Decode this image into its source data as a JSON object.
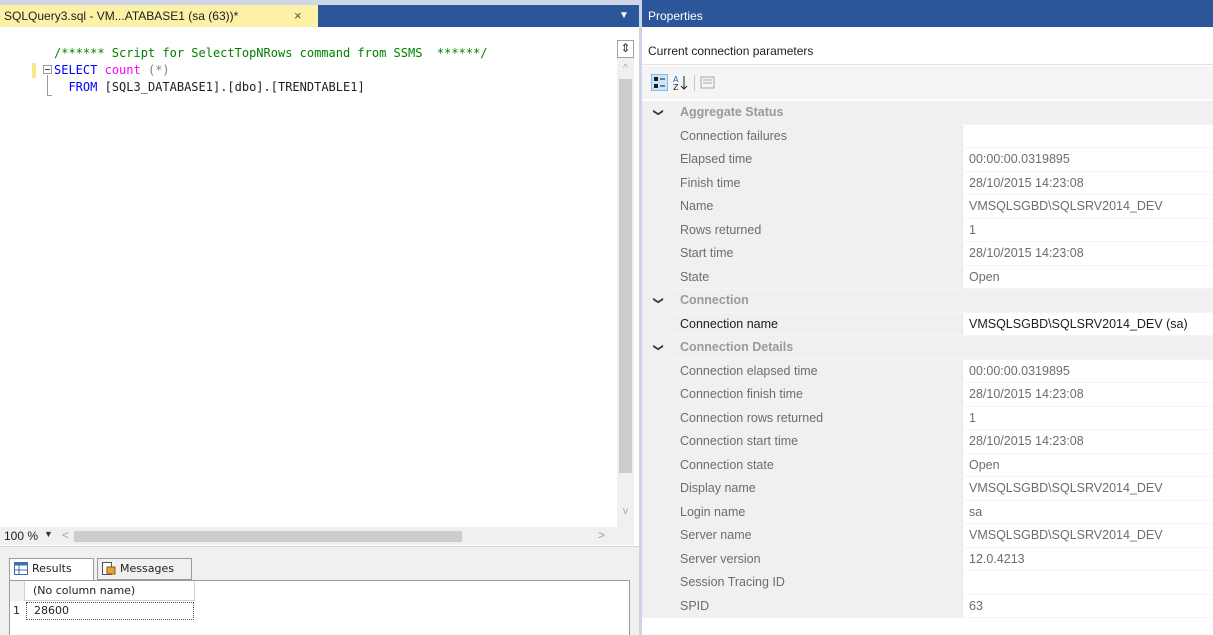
{
  "editor": {
    "tab_title": "SQLQuery3.sql - VM...ATABASE1 (sa (63))*",
    "tab_close": "×",
    "dropdown_glyph": "▼",
    "line1": "/****** Script for SelectTopNRows command from SSMS  ******/",
    "line2_kw": "SELECT",
    "line2_fn": "count",
    "line2_args": "(*)",
    "line3_kw": "FROM",
    "line3_obj": "[SQL3_DATABASE1].[dbo].[TRENDTABLE1]",
    "zoom": "100 %",
    "split_glyph": "⇕"
  },
  "results": {
    "tabs": [
      {
        "label": "Results"
      },
      {
        "label": "Messages"
      }
    ],
    "column_header": "(No column name)",
    "row_number": "1",
    "cell_value": "28600"
  },
  "properties": {
    "title": "Properties",
    "object": "Current connection parameters",
    "rows": [
      {
        "type": "category",
        "name": "Aggregate Status"
      },
      {
        "type": "prop",
        "name": "Connection failures",
        "value": ""
      },
      {
        "type": "prop",
        "name": "Elapsed time",
        "value": "00:00:00.0319895"
      },
      {
        "type": "prop",
        "name": "Finish time",
        "value": "28/10/2015 14:23:08"
      },
      {
        "type": "prop",
        "name": "Name",
        "value": "VMSQLSGBD\\SQLSRV2014_DEV"
      },
      {
        "type": "prop",
        "name": "Rows returned",
        "value": "1"
      },
      {
        "type": "prop",
        "name": "Start time",
        "value": "28/10/2015 14:23:08"
      },
      {
        "type": "prop",
        "name": "State",
        "value": "Open"
      },
      {
        "type": "category",
        "name": "Connection"
      },
      {
        "type": "prop",
        "name": "Connection name",
        "value": "VMSQLSGBD\\SQLSRV2014_DEV (sa)",
        "active": true
      },
      {
        "type": "category",
        "name": "Connection Details"
      },
      {
        "type": "prop",
        "name": "Connection elapsed time",
        "value": "00:00:00.0319895"
      },
      {
        "type": "prop",
        "name": "Connection finish time",
        "value": "28/10/2015 14:23:08"
      },
      {
        "type": "prop",
        "name": "Connection rows returned",
        "value": "1"
      },
      {
        "type": "prop",
        "name": "Connection start time",
        "value": "28/10/2015 14:23:08"
      },
      {
        "type": "prop",
        "name": "Connection state",
        "value": "Open"
      },
      {
        "type": "prop",
        "name": "Display name",
        "value": "VMSQLSGBD\\SQLSRV2014_DEV"
      },
      {
        "type": "prop",
        "name": "Login name",
        "value": "sa"
      },
      {
        "type": "prop",
        "name": "Server name",
        "value": "VMSQLSGBD\\SQLSRV2014_DEV"
      },
      {
        "type": "prop",
        "name": "Server version",
        "value": "12.0.4213"
      },
      {
        "type": "prop",
        "name": "Session Tracing ID",
        "value": ""
      },
      {
        "type": "prop",
        "name": "SPID",
        "value": "63"
      }
    ]
  },
  "colors": {
    "title_blue": "#2b579a",
    "active_tab": "#fdf0a7",
    "keyword": "#0000ff",
    "function": "#ff00ff",
    "comment": "#008000"
  },
  "icons": [
    "close-icon",
    "dropdown-icon",
    "split-icon",
    "results-grid-icon",
    "messages-icon",
    "categorized-icon",
    "alphabetical-icon",
    "property-pages-icon",
    "chevron-down-icon"
  ]
}
